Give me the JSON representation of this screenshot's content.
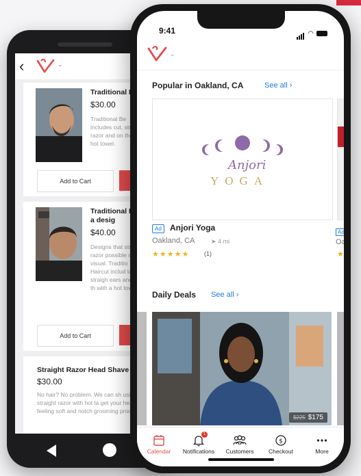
{
  "android": {
    "cards": [
      {
        "title": "Traditional B",
        "price": "$30.00",
        "desc": "Traditional Be includes cut, straight razor and on the b a hot towel.",
        "cart_label": "Add to Cart"
      },
      {
        "title": "Traditional B with a desig",
        "price": "$40.00",
        "desc": "Designs that straight razor possible so w visual. Traditio Haircut includ lather, straigh ears and on th with a hot tow",
        "cart_label": "Add to Cart"
      },
      {
        "title": "Straight Razor Head Shave",
        "price": "$30.00",
        "desc": "No hair? No problem. We can sh using a straight razor with hot la get your head feeling soft and notch grooming products."
      }
    ]
  },
  "iphone": {
    "status": {
      "time": "9:41"
    },
    "popular": {
      "title": "Popular in Oakland, CA",
      "see_all": "See all ›"
    },
    "business": {
      "ad": "Ad",
      "name": "Anjori Yoga",
      "location": "Oakland, CA",
      "distance": "4 mi",
      "stars": "★★★★★",
      "rating": 5,
      "reviews": "(1)",
      "logo_word": "YOGA",
      "logo_script": "Anjori"
    },
    "peek": {
      "ad": "Ad",
      "location": "Oal",
      "stars": "★"
    },
    "deals": {
      "title": "Daily Deals",
      "see_all": "See all ›",
      "old_price": "$225",
      "price": "$175"
    },
    "tabs": [
      {
        "label": "Calendar",
        "icon": "calendar-icon"
      },
      {
        "label": "Notifications",
        "icon": "bell-icon",
        "badge": "1"
      },
      {
        "label": "Customers",
        "icon": "customers-icon"
      },
      {
        "label": "Checkout",
        "icon": "dollar-icon"
      },
      {
        "label": "More",
        "icon": "more-icon"
      }
    ]
  },
  "colors": {
    "brand_red": "#e24a4a",
    "link_blue": "#1e7cd6",
    "star_gold": "#f2b01e"
  }
}
